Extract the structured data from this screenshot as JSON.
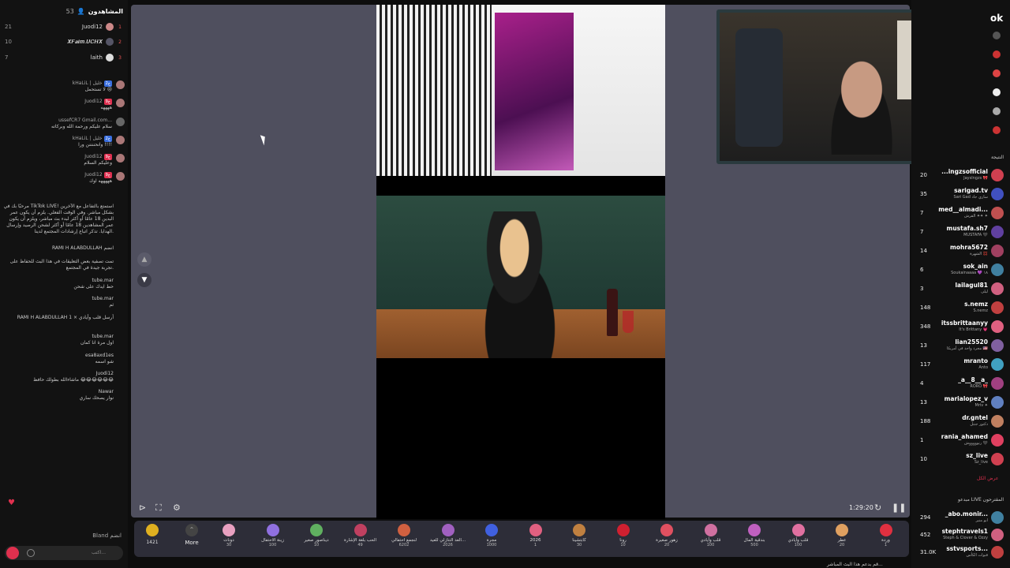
{
  "viewers": {
    "title": "المشاهدون",
    "count": "53",
    "top": [
      {
        "rank": "21",
        "name": "Juodi12",
        "level": "1"
      },
      {
        "rank": "10",
        "name": "𝑿𝑭𝒂𝒊𝒎.𝑼𝑪𝑯𝑿",
        "level": "2"
      },
      {
        "rank": "7",
        "name": "laith",
        "level": "3"
      }
    ]
  },
  "chat": [
    {
      "user": "kHaLiL | خليل",
      "tag": "2ج",
      "text": "لا تستحمل 😢"
    },
    {
      "user": "Juodi12",
      "tag": "9ج",
      "text": "ههههه"
    },
    {
      "user": "ussefCR7 Gmail.com...",
      "tag": "",
      "text": "سلام عليكم ورحمة الله وبركاته"
    },
    {
      "user": "kHaLiL | خليل",
      "tag": "2ج",
      "text": "وانحننننن ورا !!!!"
    },
    {
      "user": "Juodi12",
      "tag": "9ج",
      "text": "وعليكم السلام"
    },
    {
      "user": "Juodi12",
      "tag": "9ج",
      "text": "هههههه اوك"
    }
  ],
  "system_notice": "مرحبًا بك في TikTok LIVE! استمتع بالتفاعل مع الآخرين بشكل مباشر. وفي الوقت الفعلي. يلزم أن يكون عمر البدين 18 عامًا أو أكثر لبدء بث مباشر، ويلزم أن يكون عمر المشاهدين 18 عامًا أو أكثر لشحن الرصيد وإرسال الهدايا. تذكر اتباع إرشادات المجتمع لدينا.",
  "chat2": [
    {
      "user": "RAMI H ALABDULLAH",
      "text": "انضم"
    },
    {
      "user": "",
      "text": "تمت تصفية بعض التعليقات في هذا البث للحفاظ على تجربة جيدة في المجتمع."
    },
    {
      "user": "tube.mar",
      "text": "حط ايدك على شحن"
    },
    {
      "user": "tube.mar",
      "text": "ثم"
    },
    {
      "user": "RAMI H ALABDULLAH",
      "text": "أرسل قلب وأيادي × 1"
    },
    {
      "user": "tube.mar",
      "text": "اول مرة انا كمان"
    },
    {
      "user": "esa8axd1es",
      "text": "شو اسمه"
    },
    {
      "user": "Juodi12",
      "text": "ماشاءالله بطولك حافظ 😂😂😂😂😂😂"
    },
    {
      "user": "Nawar",
      "text": "نوار يصحك ساري"
    }
  ],
  "footer_chat": {
    "user": "Bland",
    "text": "انضم"
  },
  "chat_input": {
    "placeholder": "اكتب..."
  },
  "player": {
    "time": "1:29:20"
  },
  "gift_bar": {
    "coins": "1421",
    "more": "More",
    "items": [
      {
        "name": "دونات",
        "price": "30"
      },
      {
        "name": "زينة الاحتفال",
        "price": "100"
      },
      {
        "name": "ديناصور صغير",
        "price": "10"
      },
      {
        "name": "الحب بلغة الإشارة",
        "price": "49"
      },
      {
        "name": "لنجمع احتفالي",
        "price": "6202"
      },
      {
        "name": "العد التنازلي للعيد...",
        "price": "2026"
      },
      {
        "name": "مجرة",
        "price": "1000"
      },
      {
        "name": "2026",
        "price": "1"
      },
      {
        "name": "كابتشينا",
        "price": "30"
      },
      {
        "name": "رونا",
        "price": "10"
      },
      {
        "name": "زهور صغيرة",
        "price": "20"
      },
      {
        "name": "قلب وأيادي",
        "price": "100"
      },
      {
        "name": "بندقية المال",
        "price": "500"
      },
      {
        "name": "قلب وأيادي",
        "price": "100"
      },
      {
        "name": "عطر",
        "price": "20"
      },
      {
        "name": "وردة",
        "price": "1"
      }
    ]
  },
  "right_panel": {
    "logo_fragment": "ok",
    "ranking_label": "النتيجة",
    "ranking": [
      {
        "score": "20",
        "name": "...ingzsofficial",
        "sub": "Jayslngzs 🎀"
      },
      {
        "score": "35",
        "name": "sarigad.tv",
        "sub": "Sari Gad ساري جاد"
      },
      {
        "score": "7",
        "name": "med__almadi...",
        "sub": "القرش ✦✦ ✦"
      },
      {
        "score": "7",
        "name": "mustafa.sh7",
        "sub": "MUSTAFA 🖤"
      },
      {
        "score": "14",
        "name": "mohra5672",
        "sub": "الشهرة 💢"
      },
      {
        "score": "6",
        "name": "sok_ain",
        "sub": "Soukainaaaa 💜 ۱۸"
      },
      {
        "score": "3",
        "name": "lailagul81",
        "sub": "ليلى"
      },
      {
        "score": "148",
        "name": "s.nemz",
        "sub": "S.nemz"
      },
      {
        "score": "348",
        "name": "itssbrittaanyy",
        "sub": "It's Brittany 💗"
      },
      {
        "score": "13",
        "name": "lian25520",
        "sub": "مجرد واحد في أمريكا 🇺🇸"
      },
      {
        "score": "117",
        "name": "mranto",
        "sub": "Anto"
      },
      {
        "score": "4",
        "name": "_a__8__a_",
        "sub": "RORO 🎀"
      },
      {
        "score": "13",
        "name": "marialopez_v",
        "sub": "Mriv ✦"
      },
      {
        "score": "188",
        "name": "dr.gntel",
        "sub": "دكتور جنتل"
      },
      {
        "score": "1",
        "name": "rania_ahamed",
        "sub": "رنوووووش 🖤"
      },
      {
        "score": "10",
        "name": "sz_live",
        "sub": "Sz_live"
      }
    ],
    "show_more": "عرض الكل",
    "suggested_label": "مبدعو LIVE المقترحون",
    "suggested": [
      {
        "score": "294",
        "name": "_abo.monir...",
        "sub": "ابو منير"
      },
      {
        "score": "452",
        "name": "stephtravels1",
        "sub": "Steph & Clover & Ozzy"
      },
      {
        "score": "31.0K",
        "name": "sstvsports...",
        "sub": "قنوات الكأس"
      }
    ],
    "ticker": "قم بدعم هذا البث المباشر..."
  },
  "colors": {
    "accent": "#e0304e",
    "stage_bg": "#4f4f5e",
    "panel_bg": "#121212"
  }
}
